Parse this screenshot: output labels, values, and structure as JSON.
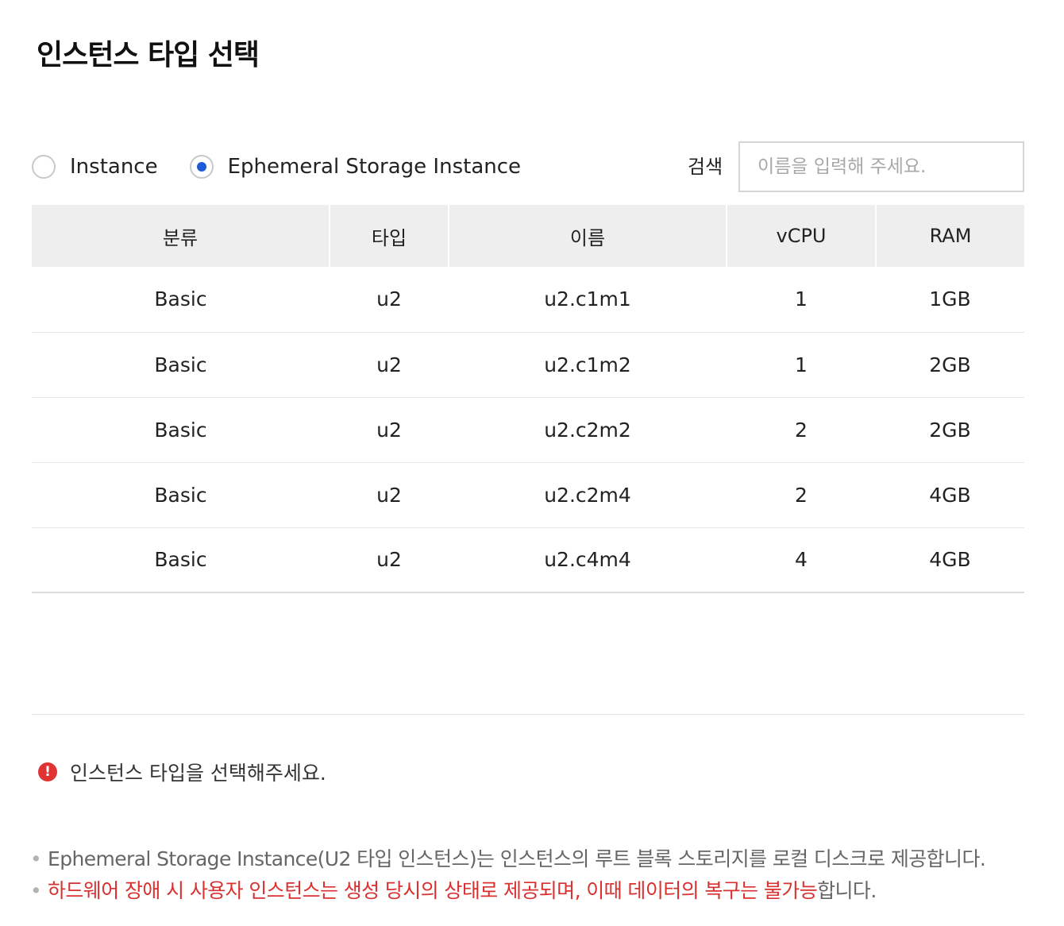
{
  "title": "인스턴스 타입 선택",
  "instance_filter": {
    "options": [
      {
        "label": "Instance",
        "selected": false
      },
      {
        "label": "Ephemeral Storage Instance",
        "selected": true
      }
    ]
  },
  "search": {
    "label": "검색",
    "placeholder": "이름을 입력해 주세요.",
    "value": ""
  },
  "table": {
    "columns": [
      "분류",
      "타입",
      "이름",
      "vCPU",
      "RAM"
    ],
    "rows": [
      [
        "Basic",
        "u2",
        "u2.c1m1",
        "1",
        "1GB"
      ],
      [
        "Basic",
        "u2",
        "u2.c1m2",
        "1",
        "2GB"
      ],
      [
        "Basic",
        "u2",
        "u2.c2m2",
        "2",
        "2GB"
      ],
      [
        "Basic",
        "u2",
        "u2.c2m4",
        "2",
        "4GB"
      ],
      [
        "Basic",
        "u2",
        "u2.c4m4",
        "4",
        "4GB"
      ]
    ]
  },
  "validation": {
    "icon": "error-icon",
    "icon_glyph": "!",
    "message": "인스턴스 타입을 선택해주세요.",
    "color": "#e03434"
  },
  "notes": {
    "bullet": "•",
    "line1": "Ephemeral Storage Instance(U2 타입 인스턴스)는 인스턴스의 루트 블록 스토리지를 로컬 디스크로 제공합니다.",
    "line2_warning": "하드웨어 장애 시 사용자 인스턴스는 생성 당시의 상태로 제공되며, 이때 데이터의 복구는 불가능",
    "line2_suffix": "합니다.",
    "warning_color": "#d93030"
  },
  "colors": {
    "accent": "#1f5bd8",
    "header_bg": "#eeeeee"
  }
}
